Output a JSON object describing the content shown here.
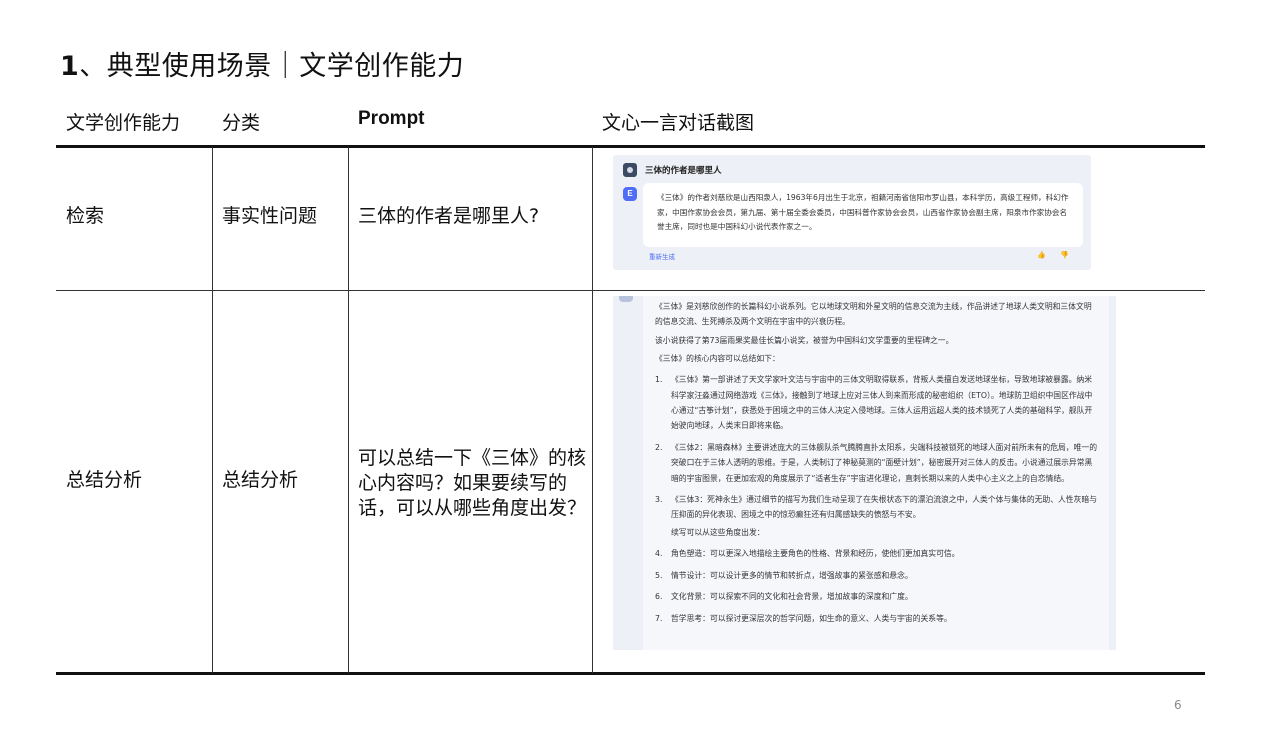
{
  "slide": {
    "title_num": "1",
    "title_text": "、典型使用场景｜文学创作能力",
    "page_number": "6"
  },
  "table": {
    "headers": [
      "文学创作能力",
      "分类",
      "Prompt",
      "文心一言对话截图"
    ],
    "rows": [
      {
        "ability": "检索",
        "category": "事实性问题",
        "prompt": "三体的作者是哪里人?"
      },
      {
        "ability": "总结分析",
        "category": "总结分析",
        "prompt": "可以总结一下《三体》的核心内容吗？如果要续写的话，可以从哪些角度出发？"
      }
    ]
  },
  "screenshot1": {
    "question": "三体的作者是哪里人",
    "bot_badge": "E",
    "answer": "《三体》的作者刘慈欣是山西阳泉人，1963年6月出生于北京，祖籍河南省信阳市罗山县，本科学历，高级工程师，科幻作家，中国作家协会会员，第九届、第十届全委会委员，中国科普作家协会会员，山西省作家协会副主席，阳泉市作家协会名誉主席，同时也是中国科幻小说代表作家之一。",
    "regenerate": "重新生成",
    "feedback": "👍 👎"
  },
  "screenshot2": {
    "intro1": "《三体》是刘慈欣创作的长篇科幻小说系列。它以地球文明和外星文明的信息交流为主线，作品讲述了地球人类文明和三体文明的信息交流、生死搏杀及两个文明在宇宙中的兴衰历程。",
    "intro2": "该小说获得了第73届雨果奖最佳长篇小说奖，被誉为中国科幻文学重要的里程碑之一。",
    "intro3": "《三体》的核心内容可以总结如下：",
    "items": [
      {
        "n": "1.",
        "text": "《三体》第一部讲述了天文学家叶文洁与宇宙中的三体文明取得联系，背叛人类擅自发送地球坐标，导致地球被暴露。纳米科学家汪淼通过网络游戏《三体》，接触到了地球上应对三体人到来而形成的秘密组织（ETO）。地球防卫组织中国区作战中心通过“古筝计划”，获悉处于困境之中的三体人决定入侵地球。三体人运用远超人类的技术锁死了人类的基础科学，舰队开始驶向地球，人类末日即将来临。"
      },
      {
        "n": "2.",
        "text": "《三体2：黑暗森林》主要讲述庞大的三体舰队杀气腾腾直扑太阳系，尖端科技被锁死的地球人面对前所未有的危局，唯一的突破口在于三体人透明的思维。于是，人类制订了神秘莫测的“面壁计划”，秘密展开对三体人的反击。小说通过展示异常黑暗的宇宙图景，在更加宏观的角度展示了“适者生存”宇宙进化理论，直刺长期以来的人类中心主义之上的自恋情结。"
      },
      {
        "n": "3.",
        "text": "《三体3：死神永生》通过细节的描写为我们生动呈现了在失根状态下的漂泊流浪之中，人类个体与集体的无助、人性灰暗与压抑面的异化表现、困境之中的惊恐癫狂还有归属感缺失的愤怒与不安。"
      }
    ],
    "continue_label": "续写可以从这些角度出发：",
    "items2": [
      {
        "n": "4.",
        "text": "角色塑造：可以更深入地描绘主要角色的性格、背景和经历，使他们更加真实可信。"
      },
      {
        "n": "5.",
        "text": "情节设计：可以设计更多的情节和转折点，增强故事的紧张感和悬念。"
      },
      {
        "n": "6.",
        "text": "文化背景：可以探索不同的文化和社会背景，增加故事的深度和广度。"
      },
      {
        "n": "7.",
        "text": "哲学思考：可以探讨更深层次的哲学问题，如生命的意义、人类与宇宙的关系等。"
      }
    ]
  }
}
